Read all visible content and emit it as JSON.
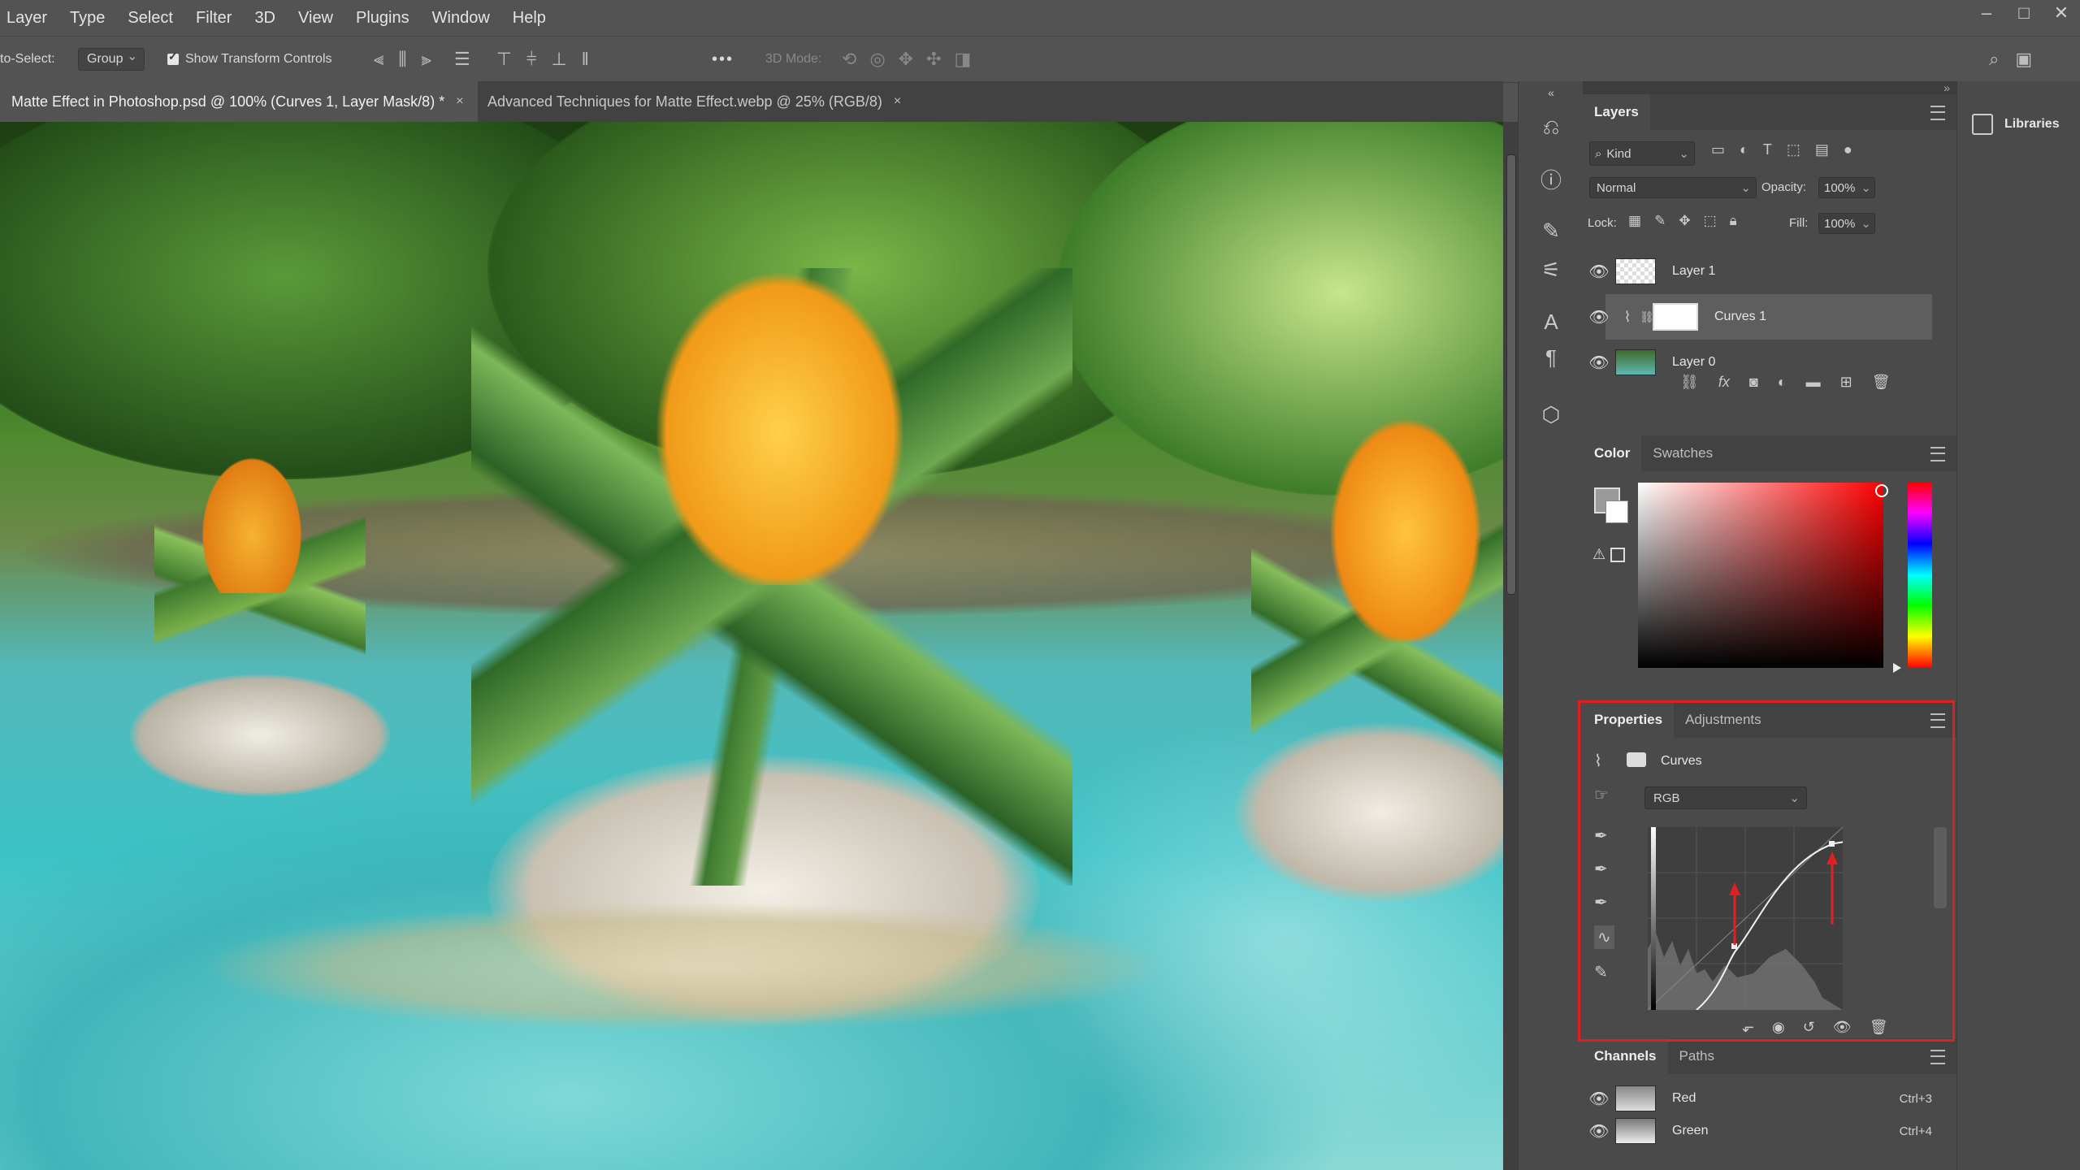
{
  "menu": [
    "Layer",
    "Type",
    "Select",
    "Filter",
    "3D",
    "View",
    "Plugins",
    "Window",
    "Help"
  ],
  "window_controls": {
    "minimize": "–",
    "maximize": "□",
    "close": "✕"
  },
  "options_bar": {
    "auto_select_label": "to-Select:",
    "group_value": "Group",
    "show_transform_label": "Show Transform Controls",
    "mode3d_label": "3D Mode:",
    "more_label": "•••"
  },
  "tabs": [
    {
      "label": "Matte Effect in Photoshop.psd @ 100% (Curves 1, Layer Mask/8) *",
      "close": "×"
    },
    {
      "label": "Advanced Techniques for Matte Effect.webp @ 25% (RGB/8)",
      "close": "×"
    }
  ],
  "layers_panel": {
    "title": "Layers",
    "filter_kind": "Kind",
    "blend_mode": "Normal",
    "opacity_label": "Opacity:",
    "opacity_value": "100%",
    "lock_label": "Lock:",
    "fill_label": "Fill:",
    "fill_value": "100%",
    "layers": [
      {
        "name": "Layer 1"
      },
      {
        "name": "Curves 1"
      },
      {
        "name": "Layer 0"
      }
    ]
  },
  "color_panel": {
    "tabs": [
      "Color",
      "Swatches"
    ]
  },
  "properties_panel": {
    "tabs": [
      "Properties",
      "Adjustments"
    ],
    "adjustment_name": "Curves",
    "channel": "RGB"
  },
  "channels_panel": {
    "tabs": [
      "Channels",
      "Paths"
    ],
    "channels": [
      {
        "name": "Red",
        "shortcut": "Ctrl+3"
      },
      {
        "name": "Green",
        "shortcut": "Ctrl+4"
      }
    ]
  },
  "libraries_label": "Libraries",
  "colors": {
    "highlight": "#e02020",
    "panel_bg": "#4a4a4a",
    "app_bg": "#535353"
  }
}
